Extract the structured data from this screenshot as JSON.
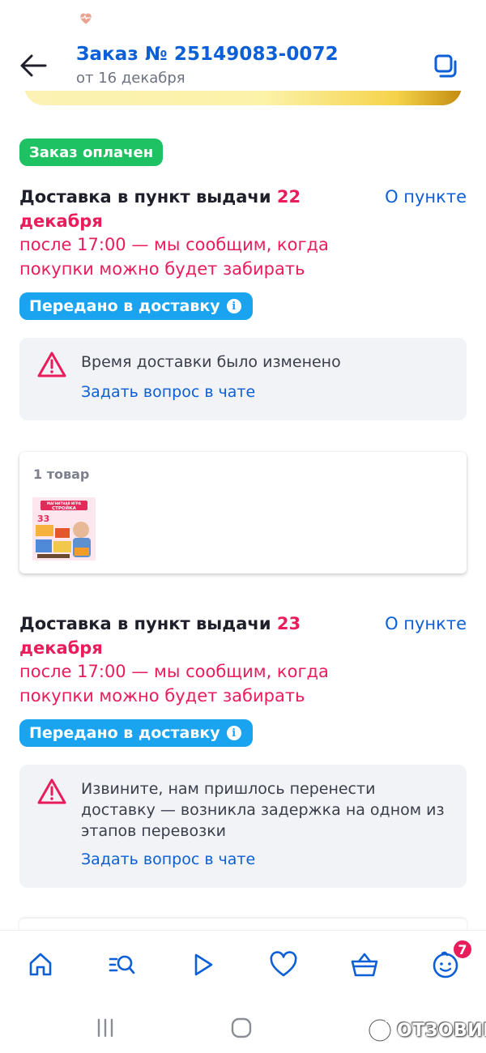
{
  "header": {
    "title": "Заказ № 25149083-0072",
    "subtitle": "от 16 декабря"
  },
  "order_status": "Заказ оплачен",
  "deliveries": [
    {
      "heading_prefix": "Доставка в пункт выдачи",
      "date": "22 декабря",
      "note": "после 17:00 — мы сообщим, когда покупки можно будет забирать",
      "about_link": "О пункте",
      "status": "Передано в доставку",
      "alert": {
        "message": "Время доставки было изменено",
        "chat_link": "Задать вопрос в чате"
      },
      "items": {
        "count_label": "1 товар"
      }
    },
    {
      "heading_prefix": "Доставка в пункт выдачи",
      "date": "23 декабря",
      "note": "после 17:00 — мы сообщим, когда покупки можно будет забирать",
      "about_link": "О пункте",
      "status": "Передано в доставку",
      "alert": {
        "message": "Извините, нам пришлось перенести доставку — возникла задержка на одном из этапов перевозки",
        "chat_link": "Задать вопрос в чате"
      }
    }
  ],
  "product": {
    "label_top": "МАГНИТНАЯ ИГРА",
    "label_title": "СТРОЙКА",
    "label_number": "33"
  },
  "bottom_nav": {
    "items": [
      "home-icon",
      "catalog-search-icon",
      "video-play-icon",
      "favorites-heart-icon",
      "cart-basket-icon",
      "profile-icon"
    ],
    "profile_badge": "7"
  },
  "watermark": {
    "text": "ОТЗОВИК"
  },
  "colors": {
    "link_blue": "#0c5fd6",
    "accent_pink": "#e91d5c",
    "paid_green": "#1ec262",
    "status_blue": "#1aa3ef",
    "alert_bg": "#f1f3f7"
  }
}
